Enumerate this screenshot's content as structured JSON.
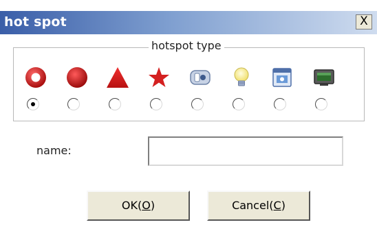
{
  "dialog": {
    "title": "hot spot",
    "close_label": "X"
  },
  "hotspot_group": {
    "legend": "hotspot type",
    "types": [
      {
        "icon": "red-ring-icon",
        "selected": true
      },
      {
        "icon": "red-circle-icon",
        "selected": false
      },
      {
        "icon": "red-triangle-icon",
        "selected": false
      },
      {
        "icon": "red-star-icon",
        "selected": false
      },
      {
        "icon": "camera-icon",
        "selected": false
      },
      {
        "icon": "light-bulb-icon",
        "selected": false
      },
      {
        "icon": "window-icon",
        "selected": false
      },
      {
        "icon": "monitor-icon",
        "selected": false
      }
    ]
  },
  "name_field": {
    "label": "name:",
    "value": ""
  },
  "buttons": {
    "ok_prefix": "OK(",
    "ok_mnemonic": "O",
    "ok_suffix": ")",
    "cancel_prefix": "Cancel(",
    "cancel_mnemonic": "C",
    "cancel_suffix": ")"
  },
  "colors": {
    "titlebar_start": "#3a5ea8",
    "titlebar_end": "#cfdcef",
    "hotspot_red": "#d42020"
  }
}
